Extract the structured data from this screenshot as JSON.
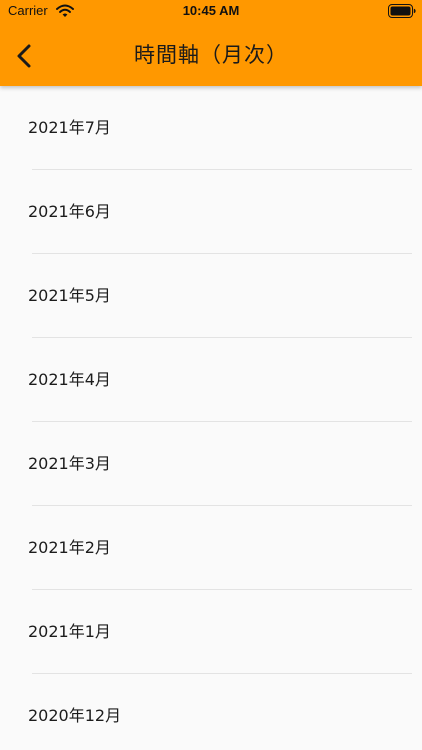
{
  "status_bar": {
    "carrier": "Carrier",
    "time": "10:45 AM"
  },
  "header": {
    "title": "時間軸（月次）",
    "background_color": "#ff9800",
    "back_icon": "chevron-left-icon"
  },
  "months": [
    {
      "label": "2021年7月"
    },
    {
      "label": "2021年6月"
    },
    {
      "label": "2021年5月"
    },
    {
      "label": "2021年4月"
    },
    {
      "label": "2021年3月"
    },
    {
      "label": "2021年2月"
    },
    {
      "label": "2021年1月"
    },
    {
      "label": "2020年12月"
    }
  ]
}
